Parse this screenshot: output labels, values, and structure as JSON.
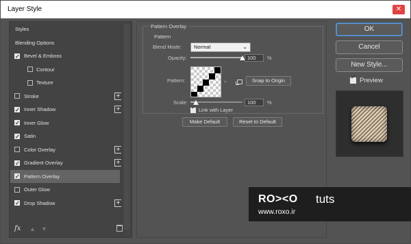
{
  "window": {
    "title": "Layer Style",
    "close_glyph": "✕"
  },
  "styles": {
    "items": [
      {
        "label": "Styles",
        "kind": "header",
        "checked": null,
        "plus": false,
        "selected": false
      },
      {
        "label": "Blending Options",
        "kind": "header",
        "checked": null,
        "plus": false,
        "selected": false
      },
      {
        "label": "Bevel & Emboss",
        "kind": "check",
        "checked": true,
        "plus": false,
        "selected": false
      },
      {
        "label": "Contour",
        "kind": "sub",
        "checked": false,
        "plus": false,
        "selected": false
      },
      {
        "label": "Texture",
        "kind": "sub",
        "checked": false,
        "plus": false,
        "selected": false
      },
      {
        "label": "Stroke",
        "kind": "check",
        "checked": false,
        "plus": true,
        "selected": false
      },
      {
        "label": "Inner Shadow",
        "kind": "check",
        "checked": true,
        "plus": true,
        "selected": false
      },
      {
        "label": "Inner Glow",
        "kind": "check",
        "checked": true,
        "plus": false,
        "selected": false
      },
      {
        "label": "Satin",
        "kind": "check",
        "checked": true,
        "plus": false,
        "selected": false
      },
      {
        "label": "Color Overlay",
        "kind": "check",
        "checked": false,
        "plus": true,
        "selected": false
      },
      {
        "label": "Gradient Overlay",
        "kind": "check",
        "checked": true,
        "plus": true,
        "selected": false
      },
      {
        "label": "Pattern Overlay",
        "kind": "check",
        "checked": true,
        "plus": false,
        "selected": true
      },
      {
        "label": "Outer Glow",
        "kind": "check",
        "checked": false,
        "plus": false,
        "selected": false
      },
      {
        "label": "Drop Shadow",
        "kind": "check",
        "checked": true,
        "plus": true,
        "selected": false
      }
    ],
    "footer": {
      "fx_label": "fx"
    }
  },
  "pattern_overlay": {
    "group_title": "Pattern Overlay",
    "subgroup_title": "Pattern",
    "blend_mode": {
      "label": "Blend Mode:",
      "value": "Normal"
    },
    "opacity": {
      "label": "Opacity:",
      "value": "100",
      "unit": "%",
      "level": 1.0
    },
    "pattern": {
      "label": "Pattern:"
    },
    "snap_button": "Snap to Origin",
    "scale": {
      "label": "Scale:",
      "value": "100",
      "unit": "%",
      "level": 0.1
    },
    "link_with_layer": {
      "label": "Link with Layer",
      "checked": true
    },
    "make_default": "Make Default",
    "reset_to_default": "Reset to Default"
  },
  "actions": {
    "ok": "OK",
    "cancel": "Cancel",
    "new_style": "New Style...",
    "preview": {
      "label": "Preview",
      "checked": true
    }
  },
  "watermark": {
    "brand": "RO><O",
    "tuts": "tuts",
    "url": "www.roxo.ir"
  }
}
